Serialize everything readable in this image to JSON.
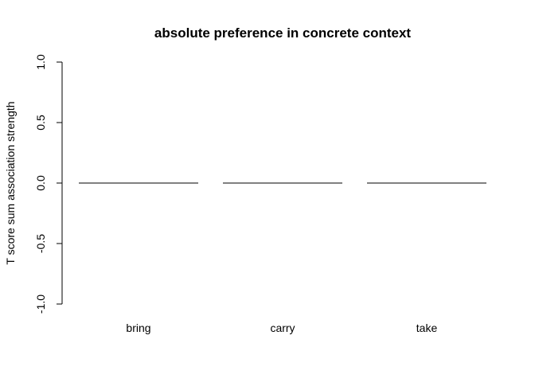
{
  "chart_data": {
    "type": "bar",
    "title": "absolute preference in concrete context",
    "xlabel": "",
    "ylabel": "T score sum association strength",
    "categories": [
      "bring",
      "carry",
      "take"
    ],
    "values": [
      0,
      0,
      0
    ],
    "ylim": [
      -1.0,
      1.0
    ],
    "yticks": [
      -1.0,
      -0.5,
      0.0,
      0.5,
      1.0
    ],
    "ytick_labels": [
      "-1.0",
      "-0.5",
      "0.0",
      "0.5",
      "1.0"
    ],
    "grid": false,
    "legend": "none",
    "bar_edge_color": "#000000",
    "bar_fill_color": "#bebebe"
  }
}
